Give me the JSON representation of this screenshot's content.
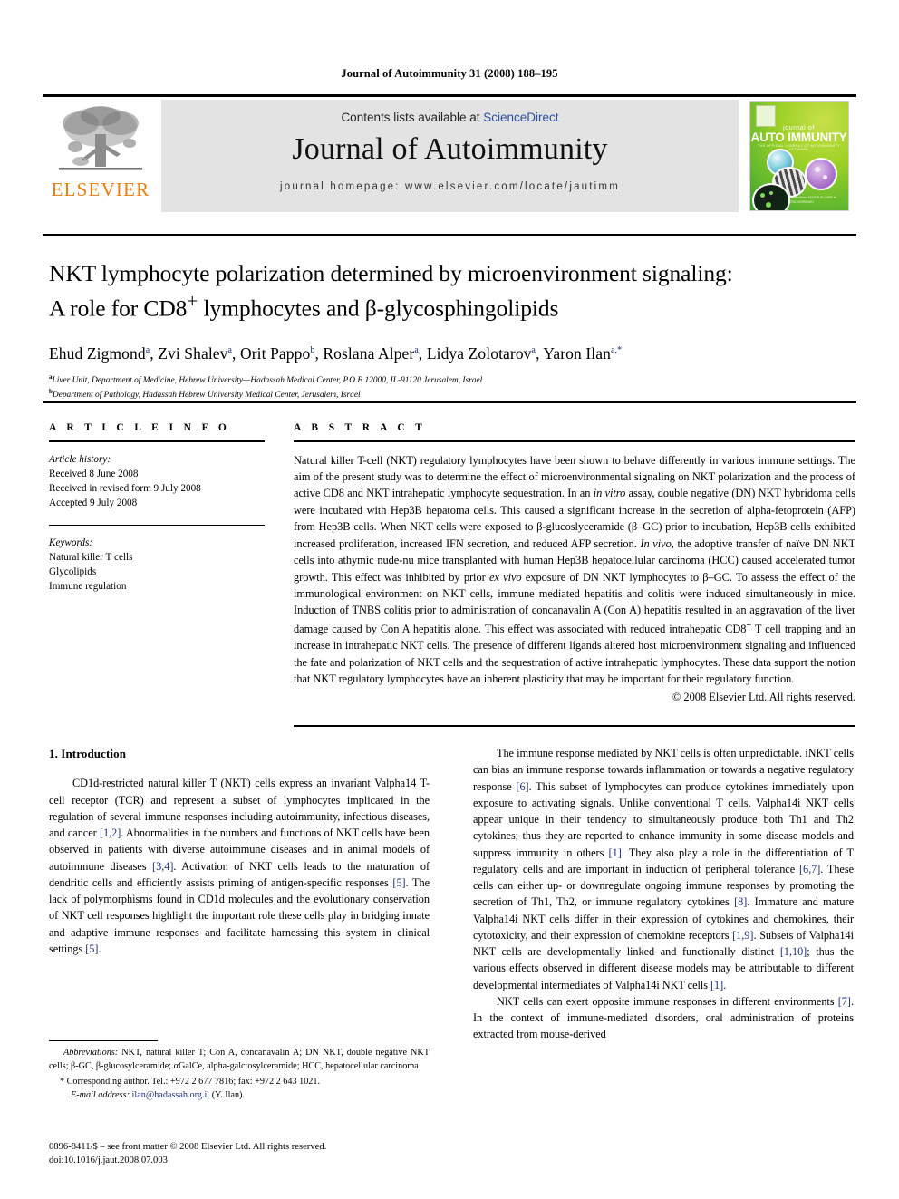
{
  "running_head": "Journal of Autoimmunity 31 (2008) 188–195",
  "masthead": {
    "contents_prefix": "Contents lists available at ",
    "sciencedirect": "ScienceDirect",
    "journal_name": "Journal of Autoimmunity",
    "homepage": "journal homepage: www.elsevier.com/locate/jautimm",
    "publisher_logo_text": "ELSEVIER",
    "cover": {
      "journal_of": "journal of",
      "title_a": "AUTO",
      "title_b": "IMMUNITY",
      "subtitle": "THE OFFICIAL JOURNAL OF AUTOIMMUNITY NETWORK",
      "footer": "ScienceDirect\nEDITOR-IN-CHIEF\nM. ERIC GERSHWIN"
    }
  },
  "article": {
    "title_line1": "NKT lymphocyte polarization determined by microenvironment signaling:",
    "title_line2_pre": "A role for CD8",
    "title_line2_sup": "+",
    "title_line2_post": " lymphocytes and β-glycosphingolipids",
    "authors": [
      {
        "name": "Ehud Zigmond",
        "sup": "a"
      },
      {
        "name": "Zvi Shalev",
        "sup": "a"
      },
      {
        "name": "Orit Pappo",
        "sup": "b"
      },
      {
        "name": "Roslana Alper",
        "sup": "a"
      },
      {
        "name": "Lidya Zolotarov",
        "sup": "a"
      },
      {
        "name": "Yaron Ilan",
        "sup": "a,*"
      }
    ],
    "affiliations": [
      {
        "marker": "a",
        "text": "Liver Unit, Department of Medicine, Hebrew University—Hadassah Medical Center, P.O.B 12000, IL-91120 Jerusalem, Israel"
      },
      {
        "marker": "b",
        "text": "Department of Pathology, Hadassah Hebrew University Medical Center, Jerusalem, Israel"
      }
    ]
  },
  "article_info": {
    "label": "A R T I C L E    I N F O",
    "history_label": "Article history:",
    "history": [
      "Received 8 June 2008",
      "Received in revised form 9 July 2008",
      "Accepted 9 July 2008"
    ],
    "keywords_label": "Keywords:",
    "keywords": [
      "Natural killer T cells",
      "Glycolipids",
      "Immune regulation"
    ]
  },
  "abstract": {
    "label": "A B S T R A C T",
    "paragraph_1": "Natural killer T-cell (NKT) regulatory lymphocytes have been shown to behave differently in various immune settings. The aim of the present study was to determine the effect of microenvironmental signaling on NKT polarization and the process of active CD8 and NKT intrahepatic lymphocyte sequestration. In an ",
    "italic_1": "in vitro",
    "paragraph_2": " assay, double negative (DN) NKT hybridoma cells were incubated with Hep3B hepatoma cells. This caused a significant increase in the secretion of alpha-fetoprotein (AFP) from Hep3B cells. When NKT cells were exposed to β-glucoslyceramide (β–GC) prior to incubation, Hep3B cells exhibited increased proliferation, increased IFN secretion, and reduced AFP secretion. ",
    "italic_2": "In vivo",
    "paragraph_3": ", the adoptive transfer of naïve DN NKT cells into athymic nude-nu mice transplanted with human Hep3B hepatocellular carcinoma (HCC) caused accelerated tumor growth. This effect was inhibited by prior ",
    "italic_3": "ex vivo",
    "paragraph_4": " exposure of DN NKT lymphocytes to β–GC. To assess the effect of the immunological environment on NKT cells, immune mediated hepatitis and colitis were induced simultaneously in mice. Induction of TNBS colitis prior to administration of concanavalin A (Con A) hepatitis resulted in an aggravation of the liver damage caused by Con A hepatitis alone. This effect was associated with reduced intrahepatic CD8",
    "sup_1": "+",
    "paragraph_5": " T cell trapping and an increase in intrahepatic NKT cells. The presence of different ligands altered host microenvironment signaling and influenced the fate and polarization of NKT cells and the sequestration of active intrahepatic lymphocytes. These data support the notion that NKT regulatory lymphocytes have an inherent plasticity that may be important for their regulatory function.",
    "copyright": "© 2008 Elsevier Ltd. All rights reserved."
  },
  "body": {
    "section_heading": "1.  Introduction",
    "left_paragraph_1_a": "CD1d-restricted natural killer T (NKT) cells express an invariant Valpha14 T-cell receptor (TCR) and represent a subset of lymphocytes implicated in the regulation of several immune responses including autoimmunity, infectious diseases, and cancer ",
    "ref_1_2": "[1,2]",
    "left_paragraph_1_b": ". Abnormalities in the numbers and functions of NKT cells have been observed in patients with diverse autoimmune diseases and in animal models of autoimmune diseases ",
    "ref_3_4": "[3,4]",
    "left_paragraph_1_c": ". Activation of NKT cells leads to the maturation of dendritic cells and efficiently assists priming of antigen-specific responses ",
    "ref_5a": "[5]",
    "left_paragraph_1_d": ". The lack of polymorphisms found in CD1d molecules and the evolutionary conservation of NKT cell responses highlight the important role these cells play in bridging innate and adaptive immune responses and facilitate harnessing this system in clinical settings ",
    "ref_5b": "[5]",
    "left_paragraph_1_e": ".",
    "right_paragraph_1_a": "The immune response mediated by NKT cells is often unpredictable. iNKT cells can bias an immune response towards inflammation or towards a negative regulatory response ",
    "ref_6": "[6]",
    "right_paragraph_1_b": ". This subset of lymphocytes can produce cytokines immediately upon exposure to activating signals. Unlike conventional T cells, Valpha14i NKT cells appear unique in their tendency to simultaneously produce both Th1 and Th2 cytokines; thus they are reported to enhance immunity in some disease models and suppress immunity in others ",
    "ref_1a": "[1]",
    "right_paragraph_1_c": ". They also play a role in the differentiation of T regulatory cells and are important in induction of peripheral tolerance ",
    "ref_6_7": "[6,7]",
    "right_paragraph_1_d": ". These cells can either up- or downregulate ongoing immune responses by promoting the secretion of Th1, Th2, or immune regulatory cytokines ",
    "ref_8": "[8]",
    "right_paragraph_1_e": ". Immature and mature Valpha14i NKT cells differ in their expression of cytokines and chemokines, their cytotoxicity, and their expression of chemokine receptors ",
    "ref_1_9": "[1,9]",
    "right_paragraph_1_f": ". Subsets of Valpha14i NKT cells are developmentally linked and functionally distinct ",
    "ref_1_10": "[1,10]",
    "right_paragraph_1_g": "; thus the various effects observed in different disease models may be attributable to different developmental intermediates of Valpha14i NKT cells ",
    "ref_1b": "[1]",
    "right_paragraph_1_h": ".",
    "right_paragraph_2_a": "NKT cells can exert opposite immune responses in different environments ",
    "ref_7": "[7]",
    "right_paragraph_2_b": ". In the context of immune-mediated disorders, oral administration of proteins extracted from mouse-derived"
  },
  "footnotes": {
    "abbrev_label": "Abbreviations:",
    "abbrev_text": " NKT, natural killer T; Con A, concanavalin A; DN NKT, double negative NKT cells; β-GC, β-glucosylceramide; αGalCe, alpha-galctosylceramide; HCC, hepatocellular carcinoma.",
    "corresponding": "* Corresponding author. Tel.: +972 2 677 7816; fax: +972 2 643 1021.",
    "email_label": "E-mail address:",
    "email": "ilan@hadassah.org.il",
    "email_suffix": " (Y. Ilan)."
  },
  "imprint": {
    "line1": "0896-8411/$ – see front matter © 2008 Elsevier Ltd. All rights reserved.",
    "line2": "doi:10.1016/j.jaut.2008.07.003"
  },
  "colors": {
    "link_blue": "#2b4fa2",
    "ref_blue": "#1b2f77",
    "elsevier_orange": "#F07D0A",
    "masthead_gray": "#e3e3e3"
  }
}
